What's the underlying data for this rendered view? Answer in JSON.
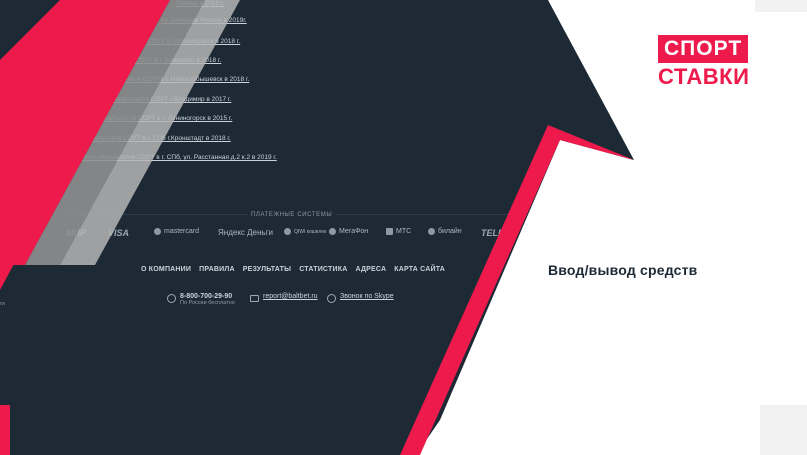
{
  "site": {
    "links": [
      "Липецк в 2016 г.",
      "по регионам России в 2019г.",
      "СОУТ в г.Краснодарск в 2018 г.",
      "СОУТ в г. Кемерово в 2018 г.",
      "ьтатов СОУТв г. Новокуйбышевск в 2018 г.",
      "результатов СОУТ г.Владимир в 2017 г.",
      "результатов СОУТ в г. Лениногорск в 2015 г.",
      "зультатов СОУТ в г. СПб г.Кронштадт в 2018 г.",
      "кость результатов СОУТ в г. СПб, ул. Расстанная д.2 к.2 в 2019 г."
    ],
    "payments_title": "ПЛАТЕЖНЫЕ СИСТЕМЫ",
    "payments": [
      "МИР",
      "VISA",
      "mastercard",
      "Яндекс Деньги",
      "QIWI кошелек",
      "МегаФон",
      "МТС",
      "билайн",
      "TELE2"
    ],
    "nav": [
      "О КОМПАНИИ",
      "ПРАВИЛА",
      "РЕЗУЛЬТАТЫ",
      "СТАТИСТИКА",
      "АДРЕСА",
      "КАРТА САЙТА"
    ],
    "contacts": {
      "phone": "8-800-700-29-90",
      "phone_note": "По России бесплатно",
      "email": "report@baltbet.ru",
      "skype": "Звонок по Skype"
    },
    "side_label": "ги"
  },
  "logo": {
    "top": "СПОРТ",
    "bottom": "СТАВКИ"
  },
  "caption": "Ввод/вывод средств",
  "colors": {
    "accent": "#ed1a4b",
    "dark": "#1d2a35",
    "white": "#ffffff"
  }
}
